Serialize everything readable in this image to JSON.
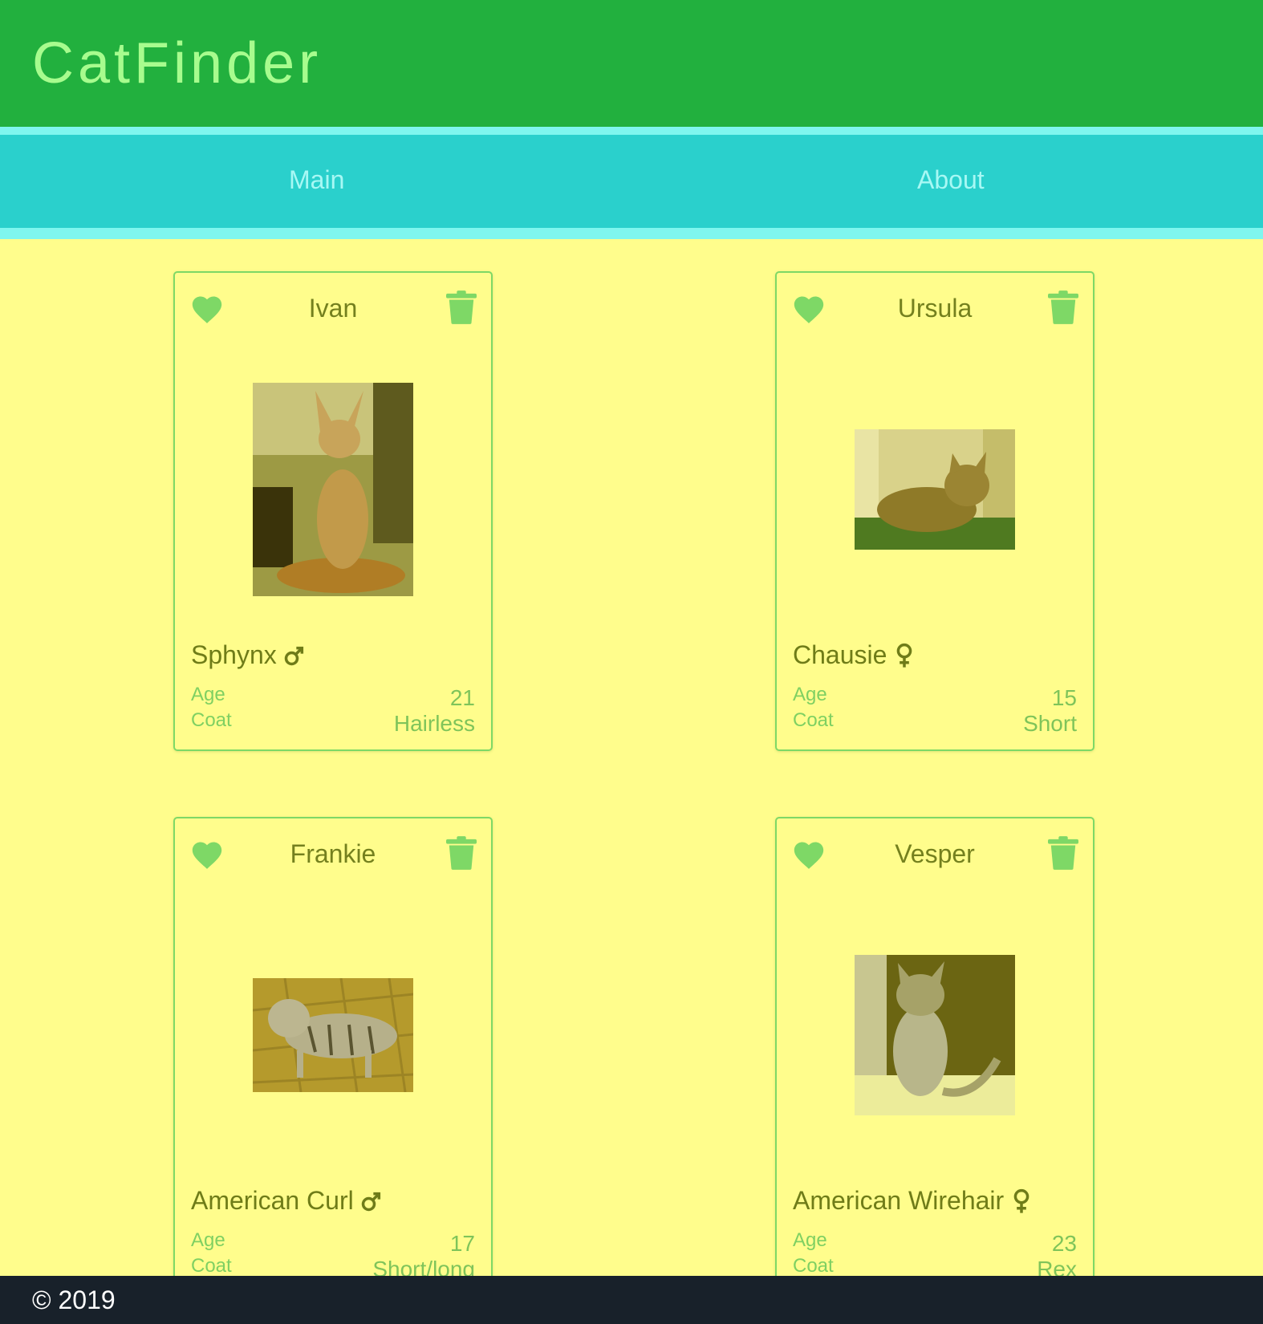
{
  "header": {
    "title": "CatFinder"
  },
  "nav": {
    "items": [
      {
        "label": "Main"
      },
      {
        "label": "About"
      }
    ]
  },
  "cards": [
    {
      "name": "Ivan",
      "breed": "Sphynx",
      "gender": "male",
      "age_label": "Age",
      "age": "21",
      "coat_label": "Coat",
      "coat": "Hairless"
    },
    {
      "name": "Ursula",
      "breed": "Chausie",
      "gender": "female",
      "age_label": "Age",
      "age": "15",
      "coat_label": "Coat",
      "coat": "Short"
    },
    {
      "name": "Frankie",
      "breed": "American Curl",
      "gender": "male",
      "age_label": "Age",
      "age": "17",
      "coat_label": "Coat",
      "coat": "Short/long"
    },
    {
      "name": "Vesper",
      "breed": "American Wirehair",
      "gender": "female",
      "age_label": "Age",
      "age": "23",
      "coat_label": "Coat",
      "coat": "Rex"
    }
  ],
  "icons": {
    "favorite": "heart-icon",
    "delete": "trash-icon",
    "male": "male-icon",
    "female": "female-icon"
  },
  "colors": {
    "header": "#22b03e",
    "nav": "#2ad0cc",
    "page": "#fffd8c",
    "footer": "#18212a",
    "accent": "#7ed866"
  },
  "footer": {
    "copyright": "© 2019"
  }
}
